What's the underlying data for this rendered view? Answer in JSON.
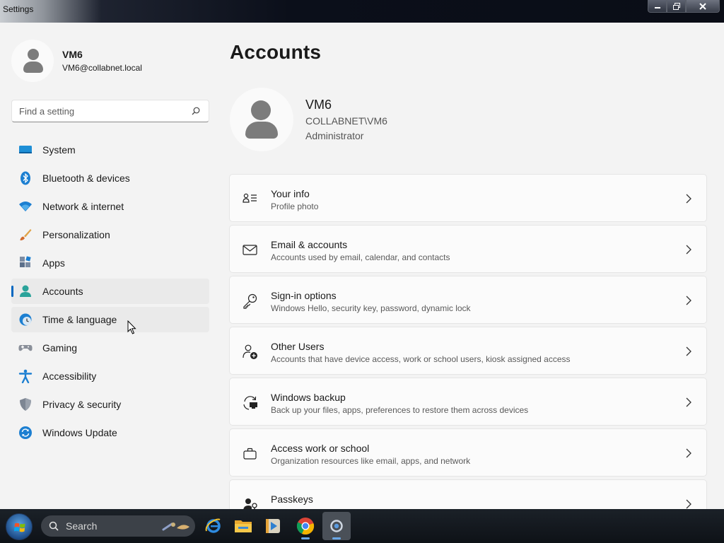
{
  "window": {
    "title": "Settings"
  },
  "profile": {
    "name": "VM6",
    "email": "VM6@collabnet.local"
  },
  "search": {
    "placeholder": "Find a setting"
  },
  "nav": {
    "items": [
      {
        "label": "System",
        "icon": "system-icon"
      },
      {
        "label": "Bluetooth & devices",
        "icon": "bluetooth-icon"
      },
      {
        "label": "Network & internet",
        "icon": "wifi-icon"
      },
      {
        "label": "Personalization",
        "icon": "brush-icon"
      },
      {
        "label": "Apps",
        "icon": "apps-icon"
      },
      {
        "label": "Accounts",
        "icon": "accounts-icon",
        "selected": true
      },
      {
        "label": "Time & language",
        "icon": "time-language-icon"
      },
      {
        "label": "Gaming",
        "icon": "gamepad-icon"
      },
      {
        "label": "Accessibility",
        "icon": "accessibility-icon"
      },
      {
        "label": "Privacy & security",
        "icon": "shield-icon"
      },
      {
        "label": "Windows Update",
        "icon": "update-icon"
      }
    ]
  },
  "main": {
    "title": "Accounts",
    "account": {
      "name": "VM6",
      "domain": "COLLABNET\\VM6",
      "role": "Administrator"
    },
    "cards": [
      {
        "title": "Your info",
        "subtitle": "Profile photo",
        "icon": "person-info-icon"
      },
      {
        "title": "Email & accounts",
        "subtitle": "Accounts used by email, calendar, and contacts",
        "icon": "mail-icon"
      },
      {
        "title": "Sign-in options",
        "subtitle": "Windows Hello, security key, password, dynamic lock",
        "icon": "key-icon"
      },
      {
        "title": "Other Users",
        "subtitle": "Accounts that have device access, work or school users, kiosk assigned access",
        "icon": "add-person-icon"
      },
      {
        "title": "Windows backup",
        "subtitle": "Back up your files, apps, preferences to restore them across devices",
        "icon": "backup-icon"
      },
      {
        "title": "Access work or school",
        "subtitle": "Organization resources like email, apps, and network",
        "icon": "briefcase-icon"
      },
      {
        "title": "Passkeys",
        "subtitle": "",
        "icon": "passkey-icon"
      }
    ]
  },
  "taskbar": {
    "search_label": "Search",
    "apps": [
      "internet-explorer-icon",
      "file-explorer-icon",
      "media-player-icon",
      "chrome-icon",
      "settings-app-icon"
    ]
  },
  "colors": {
    "accent": "#0067c0",
    "window_bg": "#f3f3f3",
    "card_bg": "#fbfbfb"
  }
}
